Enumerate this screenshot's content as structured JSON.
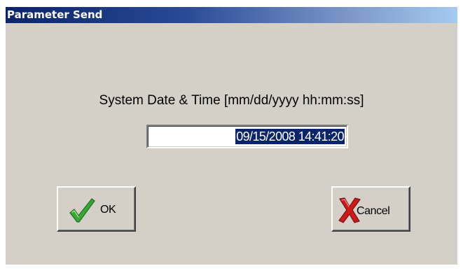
{
  "window": {
    "title": "Parameter Send"
  },
  "prompt": {
    "label": "System Date & Time [mm/dd/yyyy hh:mm:ss]"
  },
  "datetime_field": {
    "value": "09/15/2008 14:41:20",
    "selected": true
  },
  "buttons": {
    "ok": {
      "label": "OK",
      "icon": "checkmark-icon"
    },
    "cancel": {
      "label": "Cancel",
      "icon": "red-x-icon"
    }
  },
  "colors": {
    "dialog_background": "#d4d0c8",
    "titlebar_start": "#0a246a",
    "titlebar_end": "#a6caf0",
    "selection_background": "#0a246a",
    "checkmark": "#3aa635",
    "cancel_x": "#cc1a1a"
  }
}
